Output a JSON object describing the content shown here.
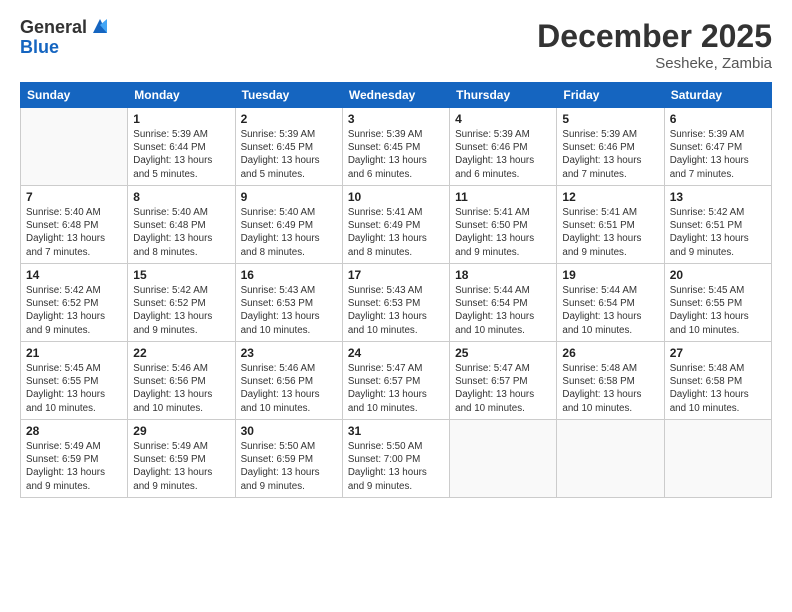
{
  "logo": {
    "general": "General",
    "blue": "Blue"
  },
  "header": {
    "month": "December 2025",
    "location": "Sesheke, Zambia"
  },
  "weekdays": [
    "Sunday",
    "Monday",
    "Tuesday",
    "Wednesday",
    "Thursday",
    "Friday",
    "Saturday"
  ],
  "weeks": [
    [
      {
        "day": "",
        "info": ""
      },
      {
        "day": "1",
        "info": "Sunrise: 5:39 AM\nSunset: 6:44 PM\nDaylight: 13 hours\nand 5 minutes."
      },
      {
        "day": "2",
        "info": "Sunrise: 5:39 AM\nSunset: 6:45 PM\nDaylight: 13 hours\nand 5 minutes."
      },
      {
        "day": "3",
        "info": "Sunrise: 5:39 AM\nSunset: 6:45 PM\nDaylight: 13 hours\nand 6 minutes."
      },
      {
        "day": "4",
        "info": "Sunrise: 5:39 AM\nSunset: 6:46 PM\nDaylight: 13 hours\nand 6 minutes."
      },
      {
        "day": "5",
        "info": "Sunrise: 5:39 AM\nSunset: 6:46 PM\nDaylight: 13 hours\nand 7 minutes."
      },
      {
        "day": "6",
        "info": "Sunrise: 5:39 AM\nSunset: 6:47 PM\nDaylight: 13 hours\nand 7 minutes."
      }
    ],
    [
      {
        "day": "7",
        "info": "Sunrise: 5:40 AM\nSunset: 6:48 PM\nDaylight: 13 hours\nand 7 minutes."
      },
      {
        "day": "8",
        "info": "Sunrise: 5:40 AM\nSunset: 6:48 PM\nDaylight: 13 hours\nand 8 minutes."
      },
      {
        "day": "9",
        "info": "Sunrise: 5:40 AM\nSunset: 6:49 PM\nDaylight: 13 hours\nand 8 minutes."
      },
      {
        "day": "10",
        "info": "Sunrise: 5:41 AM\nSunset: 6:49 PM\nDaylight: 13 hours\nand 8 minutes."
      },
      {
        "day": "11",
        "info": "Sunrise: 5:41 AM\nSunset: 6:50 PM\nDaylight: 13 hours\nand 9 minutes."
      },
      {
        "day": "12",
        "info": "Sunrise: 5:41 AM\nSunset: 6:51 PM\nDaylight: 13 hours\nand 9 minutes."
      },
      {
        "day": "13",
        "info": "Sunrise: 5:42 AM\nSunset: 6:51 PM\nDaylight: 13 hours\nand 9 minutes."
      }
    ],
    [
      {
        "day": "14",
        "info": "Sunrise: 5:42 AM\nSunset: 6:52 PM\nDaylight: 13 hours\nand 9 minutes."
      },
      {
        "day": "15",
        "info": "Sunrise: 5:42 AM\nSunset: 6:52 PM\nDaylight: 13 hours\nand 9 minutes."
      },
      {
        "day": "16",
        "info": "Sunrise: 5:43 AM\nSunset: 6:53 PM\nDaylight: 13 hours\nand 10 minutes."
      },
      {
        "day": "17",
        "info": "Sunrise: 5:43 AM\nSunset: 6:53 PM\nDaylight: 13 hours\nand 10 minutes."
      },
      {
        "day": "18",
        "info": "Sunrise: 5:44 AM\nSunset: 6:54 PM\nDaylight: 13 hours\nand 10 minutes."
      },
      {
        "day": "19",
        "info": "Sunrise: 5:44 AM\nSunset: 6:54 PM\nDaylight: 13 hours\nand 10 minutes."
      },
      {
        "day": "20",
        "info": "Sunrise: 5:45 AM\nSunset: 6:55 PM\nDaylight: 13 hours\nand 10 minutes."
      }
    ],
    [
      {
        "day": "21",
        "info": "Sunrise: 5:45 AM\nSunset: 6:55 PM\nDaylight: 13 hours\nand 10 minutes."
      },
      {
        "day": "22",
        "info": "Sunrise: 5:46 AM\nSunset: 6:56 PM\nDaylight: 13 hours\nand 10 minutes."
      },
      {
        "day": "23",
        "info": "Sunrise: 5:46 AM\nSunset: 6:56 PM\nDaylight: 13 hours\nand 10 minutes."
      },
      {
        "day": "24",
        "info": "Sunrise: 5:47 AM\nSunset: 6:57 PM\nDaylight: 13 hours\nand 10 minutes."
      },
      {
        "day": "25",
        "info": "Sunrise: 5:47 AM\nSunset: 6:57 PM\nDaylight: 13 hours\nand 10 minutes."
      },
      {
        "day": "26",
        "info": "Sunrise: 5:48 AM\nSunset: 6:58 PM\nDaylight: 13 hours\nand 10 minutes."
      },
      {
        "day": "27",
        "info": "Sunrise: 5:48 AM\nSunset: 6:58 PM\nDaylight: 13 hours\nand 10 minutes."
      }
    ],
    [
      {
        "day": "28",
        "info": "Sunrise: 5:49 AM\nSunset: 6:59 PM\nDaylight: 13 hours\nand 9 minutes."
      },
      {
        "day": "29",
        "info": "Sunrise: 5:49 AM\nSunset: 6:59 PM\nDaylight: 13 hours\nand 9 minutes."
      },
      {
        "day": "30",
        "info": "Sunrise: 5:50 AM\nSunset: 6:59 PM\nDaylight: 13 hours\nand 9 minutes."
      },
      {
        "day": "31",
        "info": "Sunrise: 5:50 AM\nSunset: 7:00 PM\nDaylight: 13 hours\nand 9 minutes."
      },
      {
        "day": "",
        "info": ""
      },
      {
        "day": "",
        "info": ""
      },
      {
        "day": "",
        "info": ""
      }
    ]
  ]
}
